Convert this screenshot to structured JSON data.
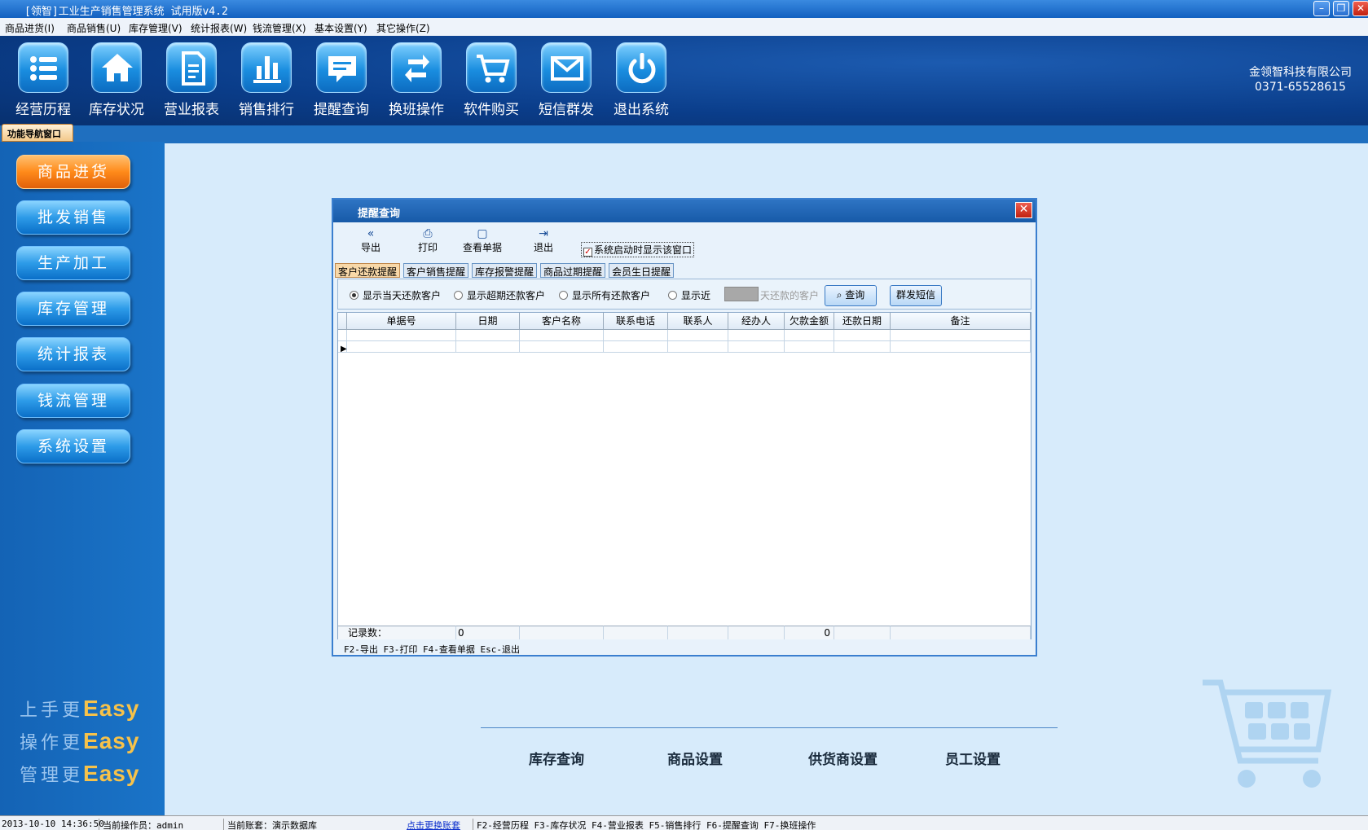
{
  "window": {
    "title": "[领智]工业生产销售管理系统 试用版v4.2"
  },
  "menu": [
    "商品进货(I)",
    "商品销售(U)",
    "库存管理(V)",
    "统计报表(W)",
    "钱流管理(X)",
    "基本设置(Y)",
    "其它操作(Z)"
  ],
  "toolbar": [
    {
      "label": "经营历程",
      "icon": "list-icon"
    },
    {
      "label": "库存状况",
      "icon": "home-icon"
    },
    {
      "label": "营业报表",
      "icon": "document-icon"
    },
    {
      "label": "销售排行",
      "icon": "bar-chart-icon"
    },
    {
      "label": "提醒查询",
      "icon": "message-icon"
    },
    {
      "label": "换班操作",
      "icon": "swap-icon"
    },
    {
      "label": "软件购买",
      "icon": "cart-icon"
    },
    {
      "label": "短信群发",
      "icon": "mail-icon"
    },
    {
      "label": "退出系统",
      "icon": "power-icon"
    }
  ],
  "company": {
    "name": "金领智科技有限公司",
    "phone": "0371-65528615"
  },
  "nav_tab": "功能导航窗口",
  "sidebar": [
    "商品进货",
    "批发销售",
    "生产加工",
    "库存管理",
    "统计报表",
    "钱流管理",
    "系统设置"
  ],
  "slogans": [
    {
      "text": "上手更",
      "word": "Easy"
    },
    {
      "text": "操作更",
      "word": "Easy"
    },
    {
      "text": "管理更",
      "word": "Easy"
    }
  ],
  "bottom_links": [
    "库存查询",
    "商品设置",
    "供货商设置",
    "员工设置"
  ],
  "dialog": {
    "title": "提醒查询",
    "toolbar": [
      {
        "label": "导出",
        "icon": "double-chevron-left-icon"
      },
      {
        "label": "打印",
        "icon": "printer-icon"
      },
      {
        "label": "查看单据",
        "icon": "view-document-icon"
      },
      {
        "label": "退出",
        "icon": "exit-icon"
      }
    ],
    "startup_checkbox": "系统启动时显示该窗口",
    "tabs": [
      "客户还款提醒",
      "客户销售提醒",
      "库存报警提醒",
      "商品过期提醒",
      "会员生日提醒"
    ],
    "radios": [
      "显示当天还款客户",
      "显示超期还款客户",
      "显示所有还款客户",
      "显示近"
    ],
    "days_suffix": "天还款的客户",
    "query_button": "查询",
    "sms_button": "群发短信",
    "columns": [
      "单据号",
      "日期",
      "客户名称",
      "联系电话",
      "联系人",
      "经办人",
      "欠款金额",
      "还款日期",
      "备注"
    ],
    "summary": {
      "label": "记录数：",
      "count": "0",
      "amount": "0"
    },
    "hint": "F2-导出 F3-打印 F4-查看单据 Esc-退出"
  },
  "statusbar": {
    "datetime": "2013-10-10 14:36:50",
    "operator": "当前操作员：admin",
    "account": "当前账套：演示数据库",
    "switch_link": "点击更换账套",
    "shortcuts": "F2-经营历程 F3-库存状况 F4-营业报表 F5-销售排行 F6-提醒查询 F7-换班操作"
  }
}
